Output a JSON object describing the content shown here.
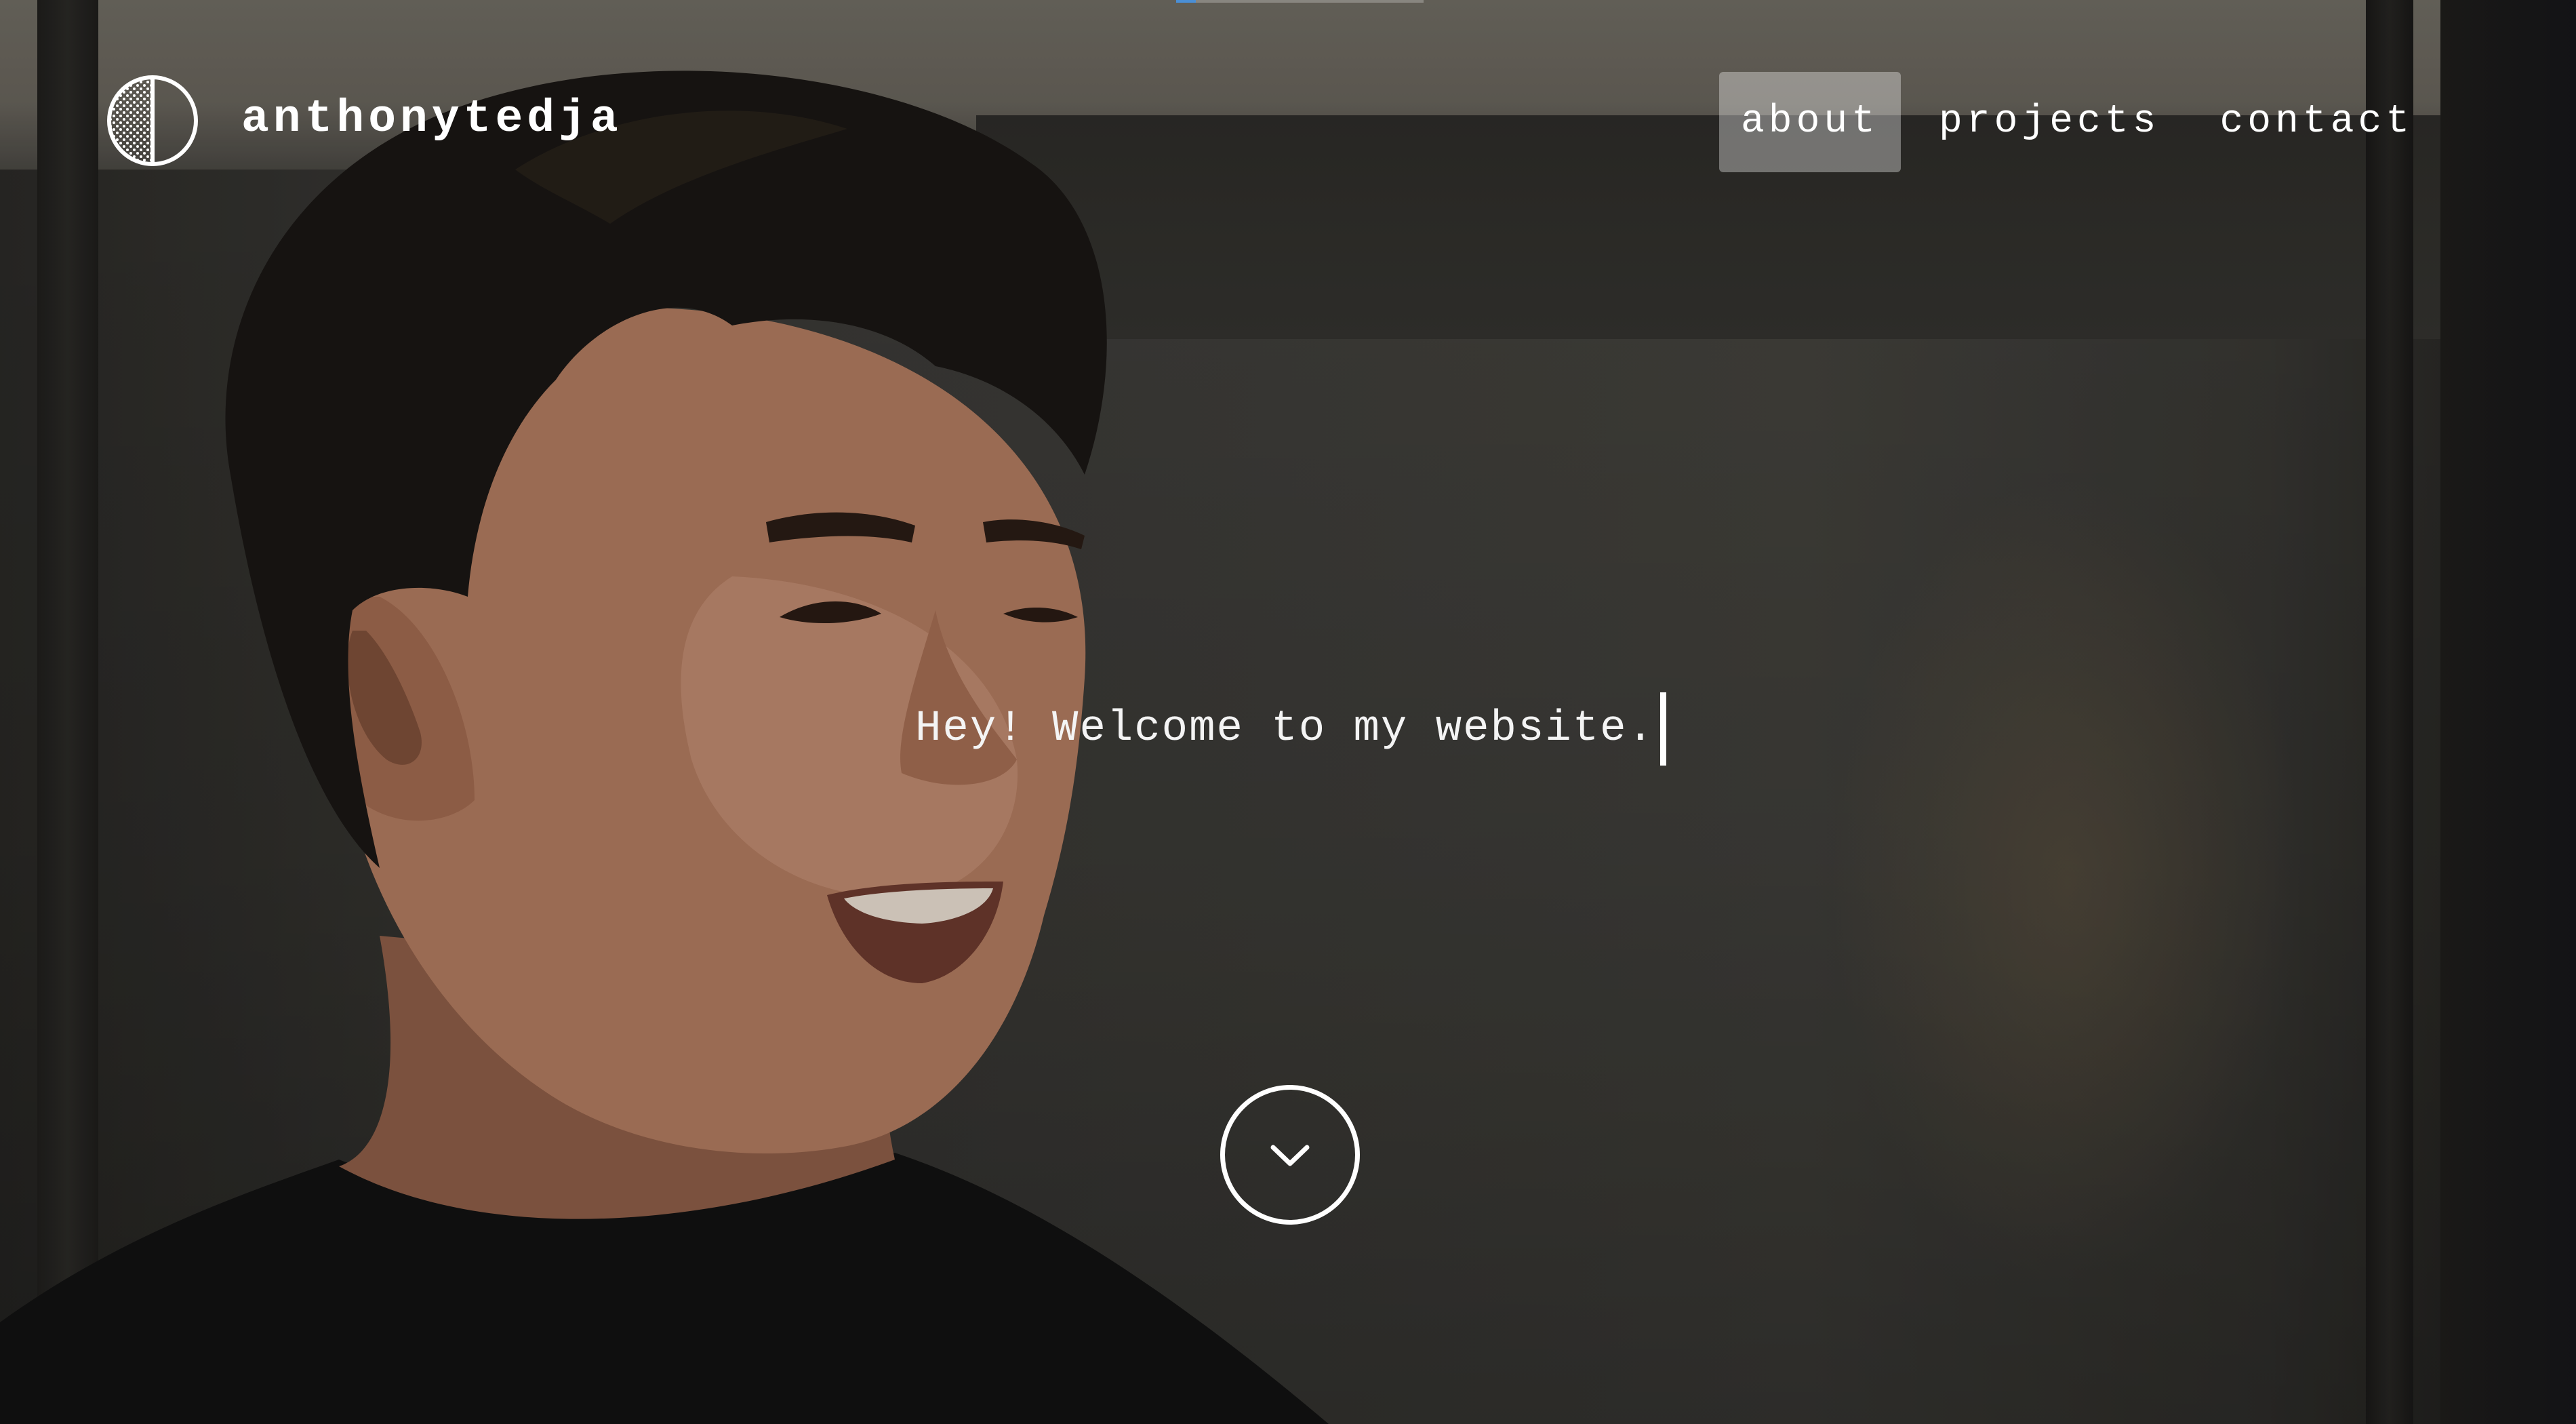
{
  "site": {
    "brand": "anthonytedja",
    "logo_icon": "half-circle-dotted-logo"
  },
  "nav": {
    "items": [
      {
        "label": "about",
        "active": true
      },
      {
        "label": "projects",
        "active": false
      },
      {
        "label": "contact",
        "active": false
      }
    ]
  },
  "hero": {
    "headline": "Hey! Welcome to my website.",
    "scroll_icon": "chevron-down-icon",
    "background_image": "portrait-photo"
  },
  "scroll_progress": 0.08,
  "colors": {
    "text": "#ffffff",
    "active_nav_bg": "#8a8985",
    "progress_accent": "#4a8fd6",
    "overlay": "#2b2a28"
  }
}
